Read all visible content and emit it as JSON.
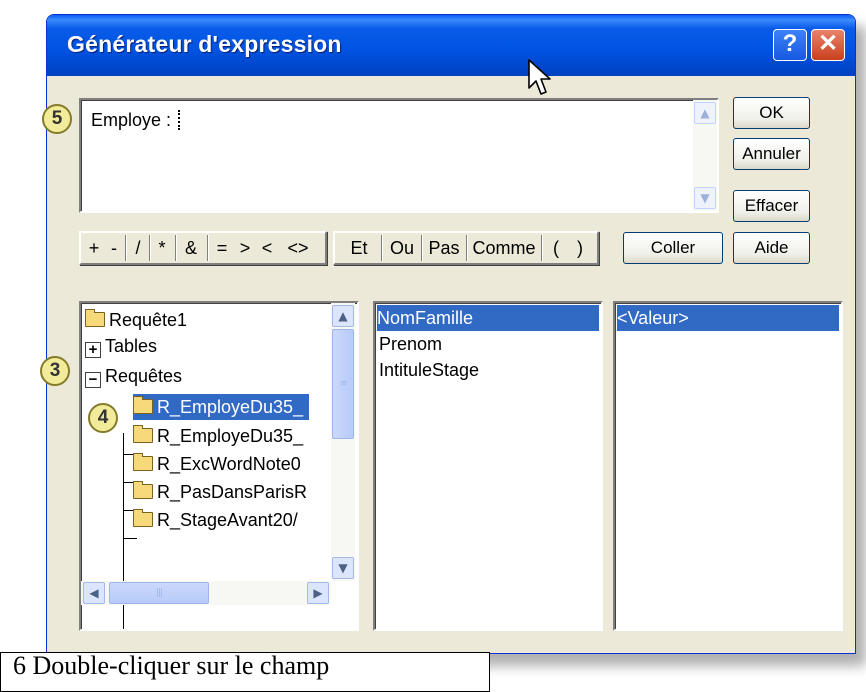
{
  "window": {
    "title": "Générateur d'expression",
    "help_label": "?",
    "close_label": "✕"
  },
  "expression": {
    "text": "Employe : "
  },
  "buttons": {
    "ok": "OK",
    "cancel": "Annuler",
    "clear": "Effacer",
    "paste": "Coller",
    "help": "Aide"
  },
  "operators": {
    "plus": "+",
    "minus": "-",
    "divide": "/",
    "multiply": "*",
    "concat": "&",
    "equal": "=",
    "greater": ">",
    "less": "<",
    "not_equal": "<>",
    "and": "Et",
    "or": "Ou",
    "not": "Pas",
    "like": "Comme",
    "open_paren": "(",
    "close_paren": ")"
  },
  "tree": {
    "items": [
      {
        "label": "Requête1",
        "icon": "folder-icon"
      },
      {
        "label": "Tables",
        "icon": "expand-icon"
      },
      {
        "label": "Requêtes",
        "icon": "collapse-icon"
      },
      {
        "label": "R_EmployeDu35_",
        "icon": "open-folder-icon",
        "selected": true
      },
      {
        "label": "R_EmployeDu35_",
        "icon": "folder-icon"
      },
      {
        "label": "R_ExcWordNote0",
        "icon": "folder-icon"
      },
      {
        "label": "R_PasDansParisR",
        "icon": "folder-icon"
      },
      {
        "label": "R_StageAvant20/",
        "icon": "folder-icon"
      }
    ]
  },
  "fields": {
    "items": [
      "NomFamille",
      "Prenom",
      "IntituleStage"
    ],
    "selected": "NomFamille"
  },
  "values": {
    "items": [
      "<Valeur>"
    ],
    "selected": "<Valeur>"
  },
  "callouts": {
    "five": "5",
    "three": "3",
    "four": "4"
  },
  "caption": {
    "text": "6   Double-cliquer sur le champ"
  },
  "colors": {
    "titlebar": "#0054e3",
    "selection": "#316ac5",
    "dialog_bg": "#ece9d8",
    "callout_fill": "#f2ec9a"
  }
}
